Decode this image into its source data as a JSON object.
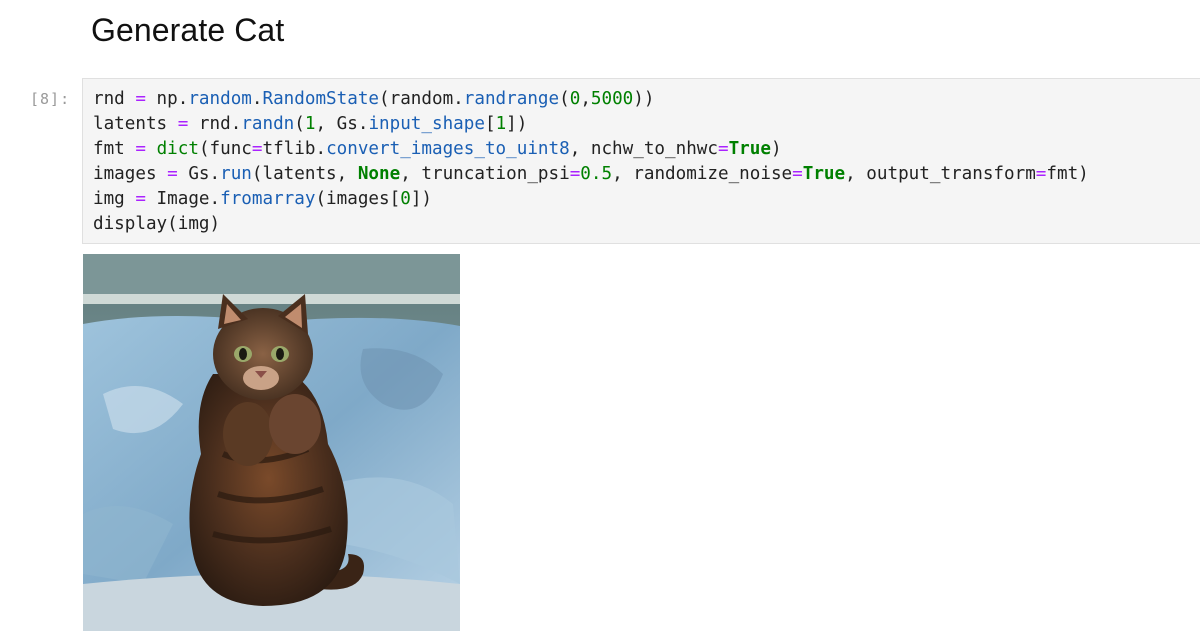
{
  "notebook": {
    "heading": "Generate Cat",
    "cell": {
      "prompt": "[8]:",
      "lines": [
        [
          {
            "t": "rnd ",
            "c": ""
          },
          {
            "t": "=",
            "c": "op"
          },
          {
            "t": " np.",
            "c": ""
          },
          {
            "t": "random",
            "c": "fn"
          },
          {
            "t": ".",
            "c": ""
          },
          {
            "t": "RandomState",
            "c": "fn"
          },
          {
            "t": "(random.",
            "c": ""
          },
          {
            "t": "randrange",
            "c": "fn"
          },
          {
            "t": "(",
            "c": ""
          },
          {
            "t": "0",
            "c": "num"
          },
          {
            "t": ",",
            "c": ""
          },
          {
            "t": "5000",
            "c": "num"
          },
          {
            "t": "))",
            "c": ""
          }
        ],
        [
          {
            "t": "latents ",
            "c": ""
          },
          {
            "t": "=",
            "c": "op"
          },
          {
            "t": " rnd.",
            "c": ""
          },
          {
            "t": "randn",
            "c": "fn"
          },
          {
            "t": "(",
            "c": ""
          },
          {
            "t": "1",
            "c": "num"
          },
          {
            "t": ", Gs.",
            "c": ""
          },
          {
            "t": "input_shape",
            "c": "fn"
          },
          {
            "t": "[",
            "c": ""
          },
          {
            "t": "1",
            "c": "num"
          },
          {
            "t": "])",
            "c": ""
          }
        ],
        [
          {
            "t": "fmt ",
            "c": ""
          },
          {
            "t": "=",
            "c": "op"
          },
          {
            "t": " ",
            "c": ""
          },
          {
            "t": "dict",
            "c": "num"
          },
          {
            "t": "(func",
            "c": ""
          },
          {
            "t": "=",
            "c": "op"
          },
          {
            "t": "tflib.",
            "c": ""
          },
          {
            "t": "convert_images_to_uint8",
            "c": "fn"
          },
          {
            "t": ", nchw_to_nhwc",
            "c": ""
          },
          {
            "t": "=",
            "c": "op"
          },
          {
            "t": "True",
            "c": "kw"
          },
          {
            "t": ")",
            "c": ""
          }
        ],
        [
          {
            "t": "images ",
            "c": ""
          },
          {
            "t": "=",
            "c": "op"
          },
          {
            "t": " Gs.",
            "c": ""
          },
          {
            "t": "run",
            "c": "fn"
          },
          {
            "t": "(latents, ",
            "c": ""
          },
          {
            "t": "None",
            "c": "kw"
          },
          {
            "t": ", truncation_psi",
            "c": ""
          },
          {
            "t": "=",
            "c": "op"
          },
          {
            "t": "0.5",
            "c": "num"
          },
          {
            "t": ", randomize_noise",
            "c": ""
          },
          {
            "t": "=",
            "c": "op"
          },
          {
            "t": "True",
            "c": "kw"
          },
          {
            "t": ", output_transform",
            "c": ""
          },
          {
            "t": "=",
            "c": "op"
          },
          {
            "t": "fmt)",
            "c": ""
          }
        ],
        [
          {
            "t": "img ",
            "c": ""
          },
          {
            "t": "=",
            "c": "op"
          },
          {
            "t": " Image.",
            "c": ""
          },
          {
            "t": "fromarray",
            "c": "fn"
          },
          {
            "t": "(images[",
            "c": ""
          },
          {
            "t": "0",
            "c": "num"
          },
          {
            "t": "])",
            "c": ""
          }
        ],
        [
          {
            "t": "display(img)",
            "c": ""
          }
        ]
      ]
    },
    "output": {
      "image_subject": "generated-cat-photo"
    }
  }
}
